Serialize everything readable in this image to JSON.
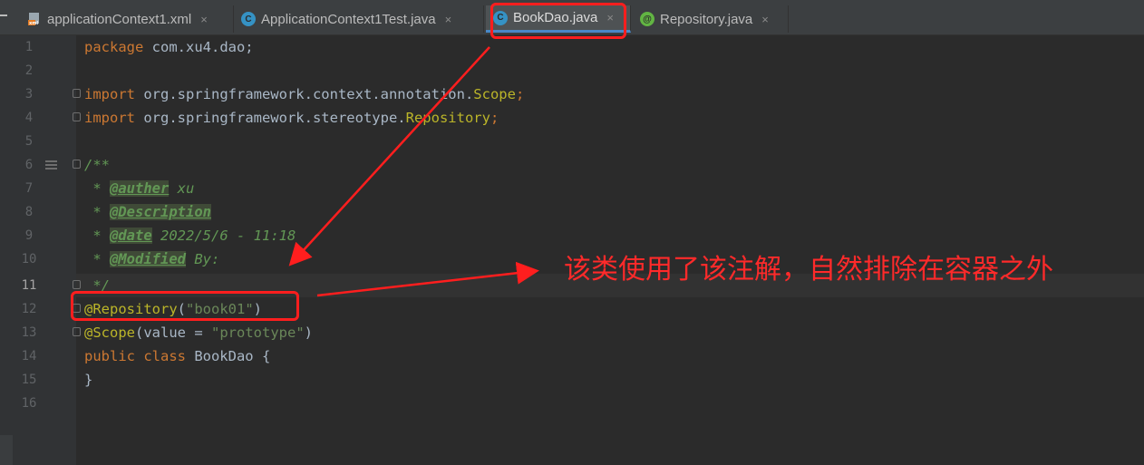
{
  "tabs": [
    {
      "label": "applicationContext1.xml",
      "icon": "xml-file-icon",
      "close": "×"
    },
    {
      "label": "ApplicationContext1Test.java",
      "icon": "java-class-icon",
      "close": "×"
    },
    {
      "label": "BookDao.java",
      "icon": "java-class-icon",
      "close": "×"
    },
    {
      "label": "Repository.java",
      "icon": "annotation-icon",
      "close": "×"
    }
  ],
  "active_tab": "BookDao.java",
  "icon_letters": {
    "class": "C",
    "annotation": "@"
  },
  "line_numbers": [
    "1",
    "2",
    "3",
    "4",
    "5",
    "6",
    "7",
    "8",
    "9",
    "10",
    "11",
    "12",
    "13",
    "14",
    "15",
    "16"
  ],
  "current_line": "11",
  "code": {
    "l1_kw": "package",
    "l1_rest": " com.xu4.dao;",
    "l3_kw": "import",
    "l3_pkg": " org.springframework.context.annotation.",
    "l3_cls": "Scope",
    "l3_end": ";",
    "l4_kw": "import",
    "l4_pkg": " org.springframework.stereotype.",
    "l4_cls": "Repository",
    "l4_end": ";",
    "l6": "/**",
    "l7_star": " * ",
    "l7_tag": "@auther",
    "l7_val": " xu",
    "l8_star": " * ",
    "l8_tag": "@Description",
    "l9_star": " * ",
    "l9_tag": "@date",
    "l9_val": " 2022/5/6 - 11:18",
    "l10_star": " * ",
    "l10_tag": "@Modified",
    "l10_val": " By:",
    "l11": " */",
    "l12_ann": "@Repository",
    "l12_open": "(",
    "l12_str": "\"book01\"",
    "l12_close": ")",
    "l13_ann": "@Scope",
    "l13_open": "(value = ",
    "l13_str": "\"prototype\"",
    "l13_close": ")",
    "l14_kw": "public class",
    "l14_rest": " BookDao {",
    "l15": "}"
  },
  "annotation_note": "该类使用了该注解，自然排除在容器之外",
  "colors": {
    "highlight": "#ff1e1e",
    "keyword": "#cc7832",
    "annotation": "#bbb529",
    "string": "#6a8759",
    "doc": "#629755"
  }
}
